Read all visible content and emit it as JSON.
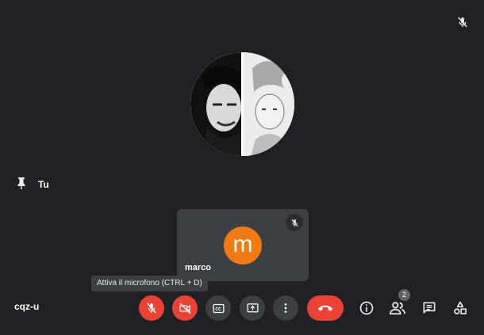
{
  "main": {
    "self_label": "Tu"
  },
  "tile": {
    "initial": "m",
    "name": "marco",
    "avatar_color": "#f07b14"
  },
  "tooltip": {
    "text": "Attiva il microfono (CTRL + D)"
  },
  "bottom_bar": {
    "meeting_code": "cqz-u",
    "people_count": "2",
    "controls": [
      "mic-off-icon",
      "camera-off-icon",
      "captions-icon",
      "present-screen-icon",
      "more-options-icon",
      "hang-up-icon"
    ],
    "side_icons": [
      "info-icon",
      "people-icon",
      "chat-icon",
      "activities-icon"
    ]
  },
  "colors": {
    "background": "#202124",
    "tile": "#3c4043",
    "danger": "#ea4335"
  }
}
